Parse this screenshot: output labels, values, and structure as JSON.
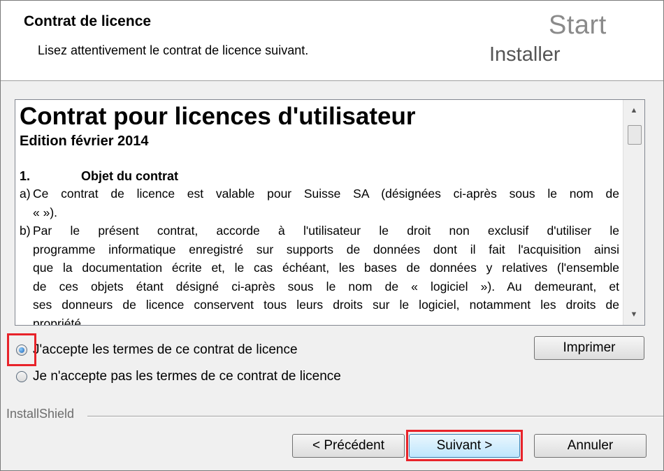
{
  "header": {
    "title": "Contrat de licence",
    "subtitle": "Lisez attentivement le contrat de licence suivant.",
    "logo_line1": "Start",
    "logo_line2": "Installer"
  },
  "license": {
    "heading": "Contrat pour licences d'utilisateur",
    "edition": "Edition février 2014",
    "section_number": "1.",
    "section_title": "Objet du contrat",
    "para_a_mark": "a)",
    "para_a_line1": "Ce contrat de licence est valable pour        Suisse SA (désignées ci-après sous le nom de",
    "para_a_line2": "«          »).",
    "para_b_mark": "b)",
    "para_b_lines": [
      "Par le présent contrat,          accorde à l'utilisateur le droit non exclusif d'utiliser le",
      "programme informatique enregistré sur supports de données dont il fait l'acquisition ainsi",
      "que la documentation écrite et, le cas échéant, les bases de données y relatives (l'ensemble",
      "de ces objets étant désigné ci-après sous le nom de « logiciel »). Au demeurant,          et",
      "ses donneurs de licence conservent tous leurs droits sur le logiciel, notamment les droits de",
      "propriété"
    ]
  },
  "radios": {
    "accept_label": "J'accepte les termes de ce contrat de licence",
    "decline_label": "Je n'accepte pas les termes de ce contrat de licence",
    "selected": "accept"
  },
  "buttons": {
    "print": "Imprimer",
    "back": "< Précédent",
    "next": "Suivant >",
    "cancel": "Annuler"
  },
  "footer": {
    "brand": "InstallShield"
  },
  "scrollbar": {
    "up_arrow": "▲",
    "down_arrow": "▼"
  },
  "colors": {
    "highlight": "#e8232a",
    "focus_border": "#3c7fb1"
  }
}
